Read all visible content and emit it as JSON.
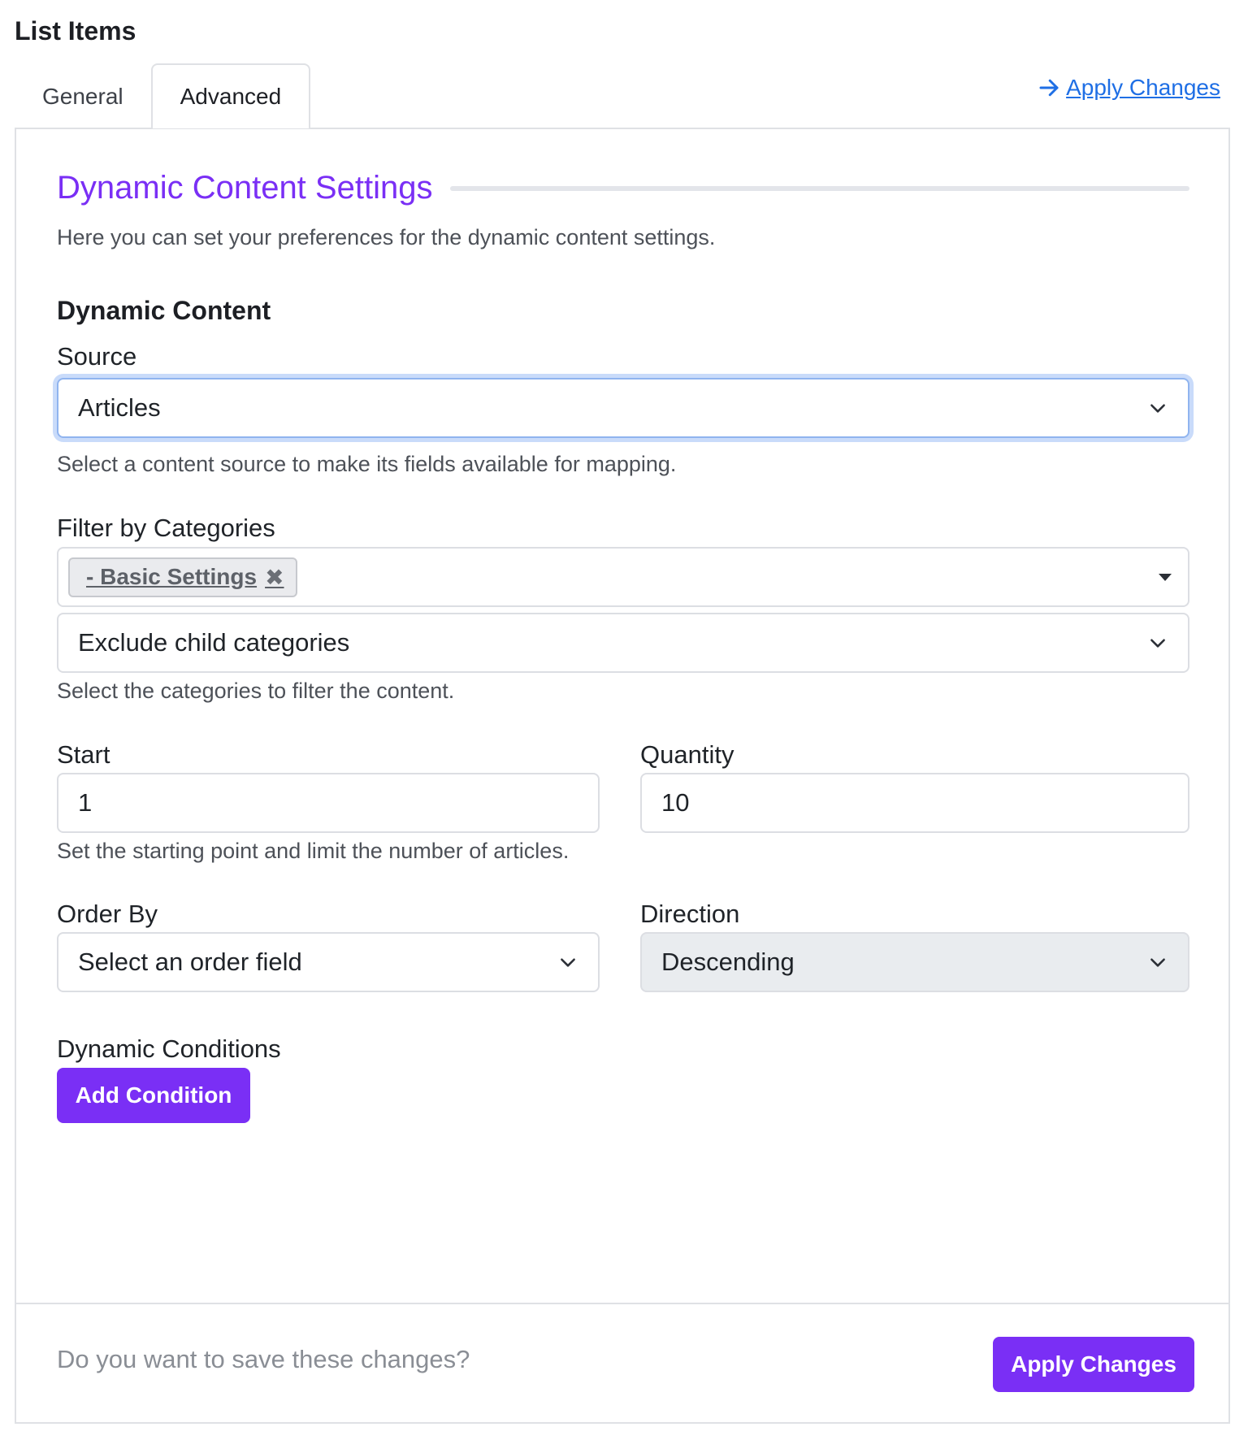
{
  "page": {
    "title": "List Items"
  },
  "tabs": [
    {
      "label": "General",
      "active": false
    },
    {
      "label": "Advanced",
      "active": true
    }
  ],
  "top_link": {
    "label": "Apply Changes",
    "icon": "arrow-right-icon"
  },
  "section": {
    "title": "Dynamic Content Settings",
    "description": "Here you can set your preferences for the dynamic content settings."
  },
  "dynamic_content": {
    "heading": "Dynamic Content",
    "source": {
      "label": "Source",
      "value": "Articles",
      "help": "Select a content source to make its fields available for mapping."
    },
    "categories": {
      "label": "Filter by Categories",
      "tags": [
        "- Basic Settings"
      ],
      "child_mode": "Exclude child categories",
      "help": "Select the categories to filter the content."
    },
    "start": {
      "label": "Start",
      "value": "1"
    },
    "quantity": {
      "label": "Quantity",
      "value": "10"
    },
    "range_help": "Set the starting point and limit the number of articles.",
    "order_by": {
      "label": "Order By",
      "value": "Select an order field"
    },
    "direction": {
      "label": "Direction",
      "value": "Descending"
    },
    "conditions": {
      "label": "Dynamic Conditions",
      "button": "Add Condition"
    }
  },
  "footer": {
    "question": "Do you want to save these changes?",
    "button": "Apply Changes"
  },
  "colors": {
    "accent": "#7a2ff5",
    "link": "#1f6fe5",
    "focus_ring": "#c9dbfa"
  }
}
